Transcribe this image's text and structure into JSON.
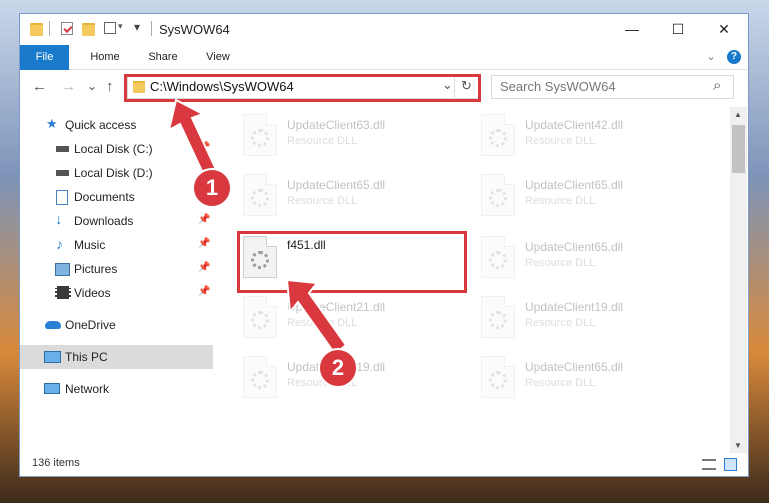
{
  "window": {
    "title": "SysWOW64",
    "minimize": "—",
    "maximize": "☐",
    "close": "✕"
  },
  "ribbon": {
    "tabs": [
      "File",
      "Home",
      "Share",
      "View"
    ],
    "collapse": "⌄",
    "help": "?"
  },
  "navigation": {
    "back": "←",
    "forward": "→",
    "recent": "⌄",
    "up": "↑",
    "address": "C:\\Windows\\SysWOW64",
    "address_dropdown": "⌄",
    "refresh": "↻",
    "search_placeholder": "Search SysWOW64",
    "search_icon": "⌕"
  },
  "sidebar": {
    "items": [
      {
        "label": "Quick access",
        "icon": "star-icon",
        "pinned": false
      },
      {
        "label": "Local Disk (C:)",
        "icon": "drive-icon",
        "pinned": true
      },
      {
        "label": "Local Disk (D:)",
        "icon": "drive-icon",
        "pinned": true
      },
      {
        "label": "Documents",
        "icon": "documents-icon",
        "pinned": true
      },
      {
        "label": "Downloads",
        "icon": "download-icon",
        "pinned": true
      },
      {
        "label": "Music",
        "icon": "music-icon",
        "pinned": true
      },
      {
        "label": "Pictures",
        "icon": "pictures-icon",
        "pinned": true
      },
      {
        "label": "Videos",
        "icon": "videos-icon",
        "pinned": true
      },
      {
        "label": "OneDrive",
        "icon": "cloud-icon",
        "pinned": false
      },
      {
        "label": "This PC",
        "icon": "computer-icon",
        "pinned": false,
        "selected": true
      },
      {
        "label": "Network",
        "icon": "network-icon",
        "pinned": false
      }
    ]
  },
  "files": [
    {
      "name": "UpdateClient63.dll",
      "type": "Resource DLL"
    },
    {
      "name": "UpdateClient42.dll",
      "type": "Resource DLL"
    },
    {
      "name": "UpdateClient65.dll",
      "type": "Resource DLL"
    },
    {
      "name": "UpdateClient65.dll",
      "type": "Resource DLL"
    },
    {
      "name": "f451.dll",
      "type": ""
    },
    {
      "name": "UpdateClient65.dll",
      "type": "Resource DLL"
    },
    {
      "name": "UpdateClient21.dll",
      "type": "Resource DLL"
    },
    {
      "name": "UpdateClient19.dll",
      "type": "Resource DLL"
    },
    {
      "name": "UpdateClient19.dll",
      "type": "Resource DLL"
    },
    {
      "name": "UpdateClient65.dll",
      "type": "Resource DLL"
    }
  ],
  "status": {
    "item_count": "136 items"
  },
  "annotations": {
    "step1": "1",
    "step2": "2",
    "highlight_color": "#d9393e"
  },
  "colors": {
    "accent": "#1979ca",
    "selection": "#dbdbdb"
  }
}
